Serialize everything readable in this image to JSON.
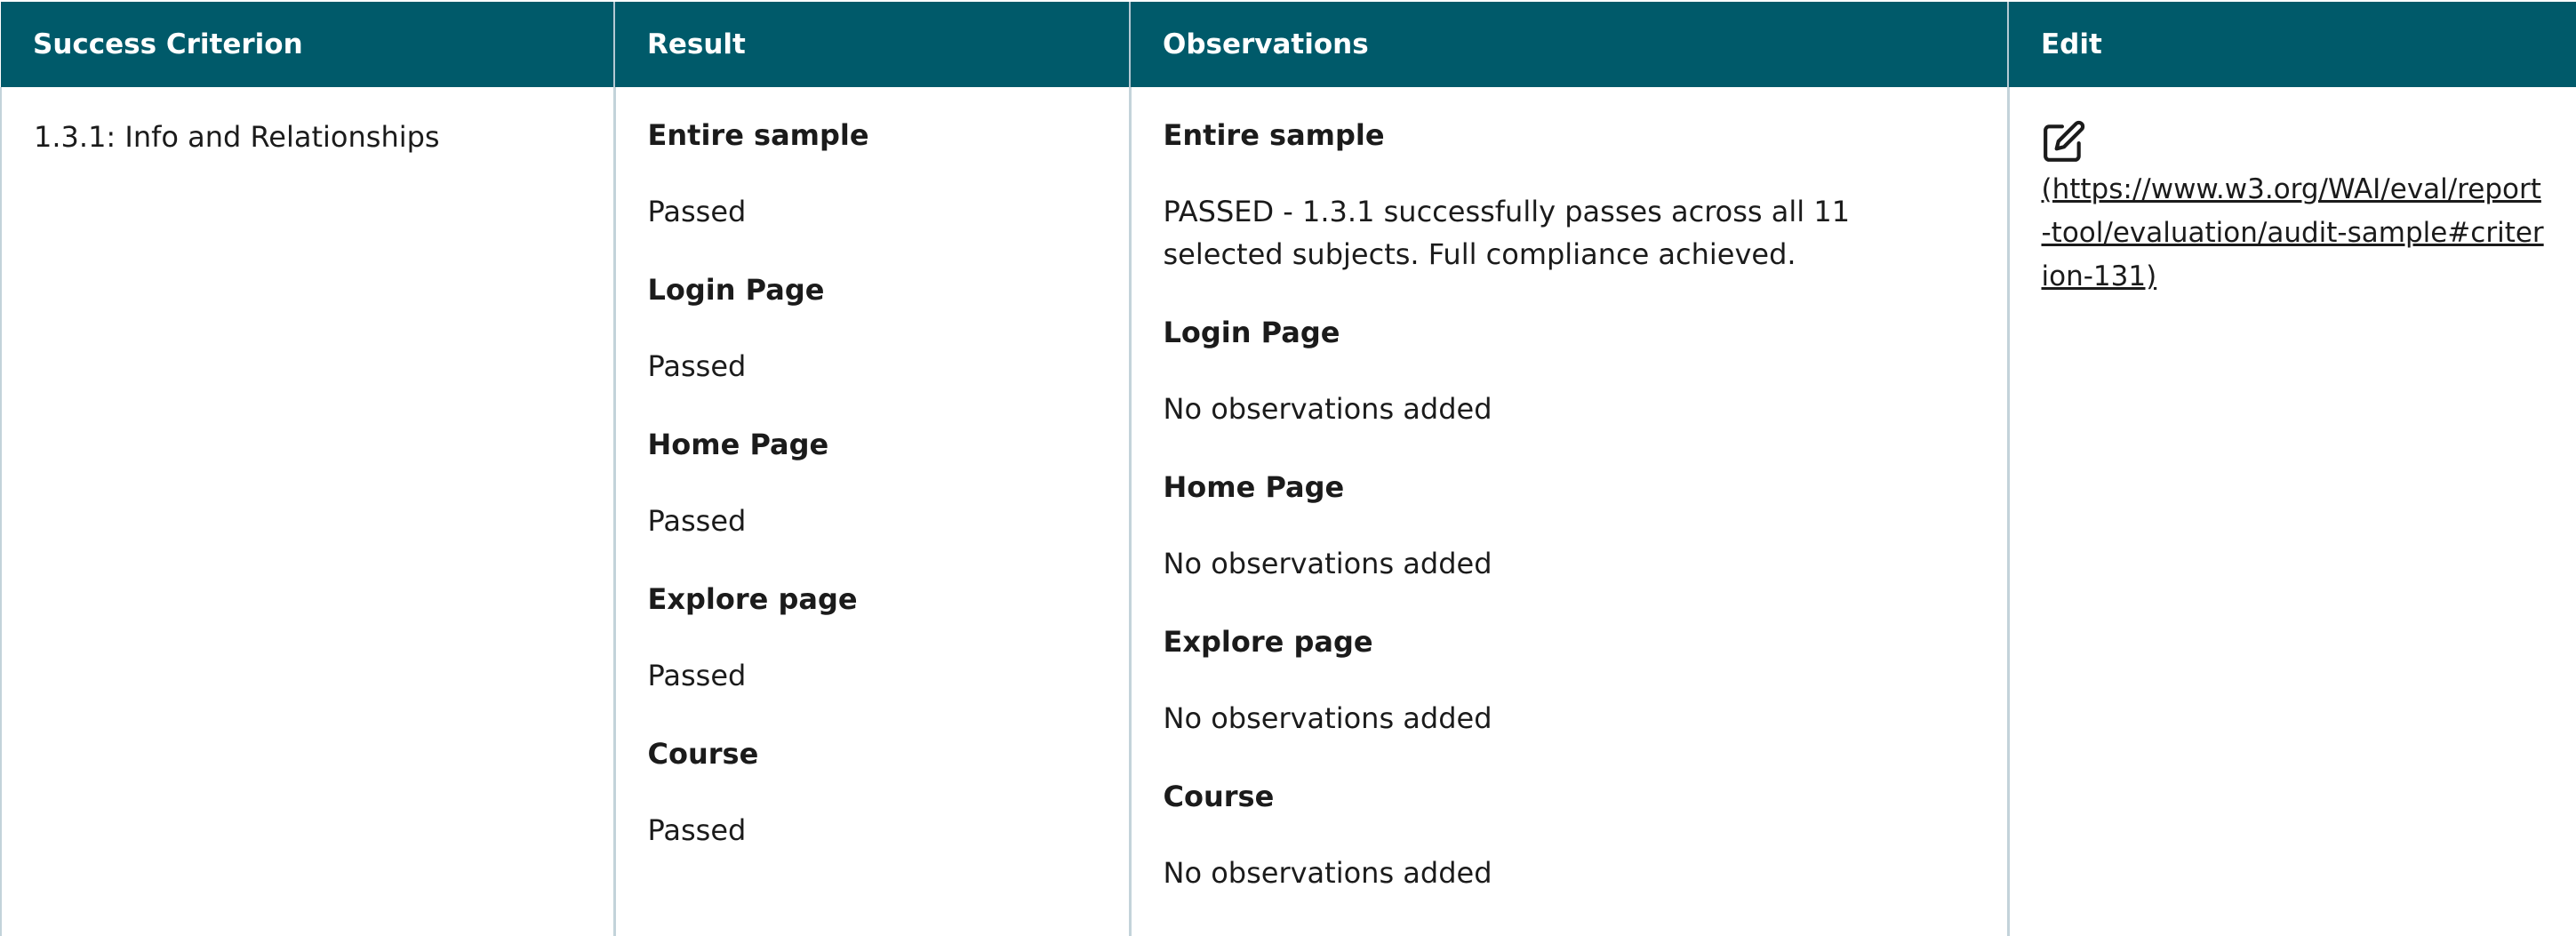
{
  "table": {
    "headers": [
      "Success Criterion",
      "Result",
      "Observations",
      "Edit"
    ]
  },
  "row": {
    "criterion": "1.3.1: Info and Relationships",
    "results": [
      {
        "title": "Entire sample",
        "value": "Passed"
      },
      {
        "title": "Login Page",
        "value": "Passed"
      },
      {
        "title": "Home Page",
        "value": "Passed"
      },
      {
        "title": "Explore page",
        "value": "Passed"
      },
      {
        "title": "Course",
        "value": "Passed"
      }
    ],
    "observations": [
      {
        "title": "Entire sample",
        "value": "PASSED - 1.3.1 successfully passes across all 11 selected subjects. Full compliance achieved."
      },
      {
        "title": "Login Page",
        "value": "No observations added"
      },
      {
        "title": "Home Page",
        "value": "No observations added"
      },
      {
        "title": "Explore page",
        "value": "No observations added"
      },
      {
        "title": "Course",
        "value": "No observations added"
      }
    ],
    "edit": {
      "icon": "edit-icon",
      "link_text": "(https://www.w3.org/WAI/eval/report-tool/evaluation/audit-sample#criterion-131)"
    }
  }
}
